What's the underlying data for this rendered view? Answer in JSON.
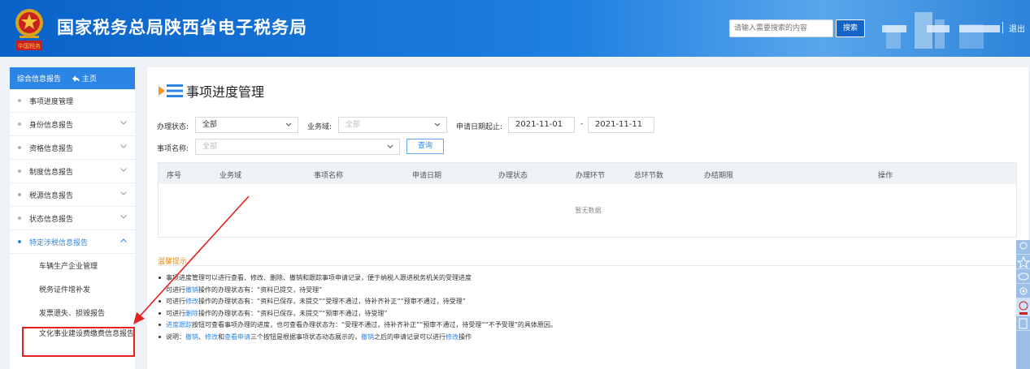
{
  "header": {
    "site_title": "国家税务总局陕西省电子税务局",
    "emblem_label": "中国税务",
    "search_placeholder": "请输入需要搜索的内容",
    "search_button": "搜索",
    "logout": "退出",
    "colors": {
      "bar": "#1d7fe0",
      "search_button": "#1565c8"
    }
  },
  "sidebar": {
    "header_title": "综合信息报告",
    "home_label": "主页",
    "items": [
      {
        "label": "事项进度管理",
        "expandable": false
      },
      {
        "label": "身份信息报告",
        "expandable": true
      },
      {
        "label": "资格信息报告",
        "expandable": true
      },
      {
        "label": "制度信息报告",
        "expandable": true
      },
      {
        "label": "税源信息报告",
        "expandable": true
      },
      {
        "label": "状态信息报告",
        "expandable": true
      },
      {
        "label": "特定涉税信息报告",
        "expandable": true,
        "expanded": true
      }
    ],
    "sub_items": [
      "车辆生产企业管理",
      "税务证件增补发",
      "发票遗失、损毁报告",
      "文化事业建设费缴费信息报告"
    ],
    "accent_color": "#2b85e4"
  },
  "main": {
    "page_title": "事项进度管理",
    "filters": {
      "status_label": "办理状态:",
      "status_value": "全部",
      "domain_label": "业务域:",
      "domain_value": "全部",
      "date_label": "申请日期起止:",
      "date_from": "2021-11-01",
      "date_sep": "-",
      "date_to": "2021-11-11",
      "item_label": "事项名称:",
      "item_value": "全部",
      "query_button": "查询"
    },
    "table": {
      "columns": [
        "序号",
        "业务域",
        "事项名称",
        "申请日期",
        "办理状态",
        "办理环节",
        "总环节数",
        "办结期限",
        "操作"
      ],
      "rows": [],
      "empty_text": "暂无数据"
    },
    "tips": {
      "title": "温馨提示",
      "lines": [
        [
          "事项进度管理可以进行查看、修改、删除、撤销和跟踪事项申请记录，便于纳税人跟进税务机关的受理进度"
        ],
        [
          "可进行",
          "撤销",
          "操作的办理状态有：“资料已提交，待受理”"
        ],
        [
          "可进行",
          "修改",
          "操作的办理状态有：“资料已保存，未提交”“受理不通过，待补齐补正”“预审不通过，待受理”"
        ],
        [
          "可进行",
          "删除",
          "操作的办理状态有：“资料已保存，未提交”“预审不通过，待受理”"
        ],
        [
          "进度跟踪",
          "按钮可查看事项办理的进度，也可查看办理状态为：“受理不通过，待补齐补正”“预审不通过，待受理”“不予受理”的具体原因。"
        ],
        [
          "说明：",
          "撤销",
          "、",
          "修改",
          "和",
          "查看申请",
          "三个按钮是根据事项状态动态展示的，",
          "撤销",
          "之后的申请记录可以进行",
          "修改",
          "操作"
        ]
      ]
    }
  },
  "right_tools": [
    "user-icon",
    "star-icon",
    "chat-icon",
    "eye-icon",
    "online-service-icon",
    "document-icon"
  ]
}
